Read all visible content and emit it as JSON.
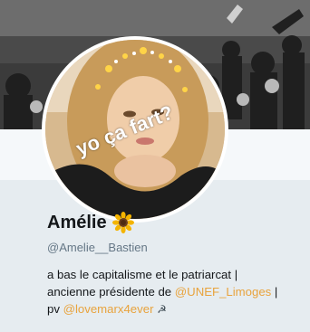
{
  "profile": {
    "name": "Amélie",
    "name_emoji": "sunflower-icon",
    "handle": "@Amelie__Bastien",
    "avatar_caption": "yo ça fart?",
    "bio": {
      "line1": "a bas le capitalisme et le patriarcat |",
      "line2_prefix": "ancienne présidente de ",
      "line2_link": "@UNEF_Limoges",
      "line2_suffix": " |",
      "line3_prefix": "pv ",
      "line3_link": "@lovemarx4ever",
      "line3_icon": "hammer-sickle-icon",
      "line3_icon_glyph": "☭"
    }
  },
  "colors": {
    "background": "#e6ecf0",
    "link": "#e8a33d",
    "name": "#14171a",
    "handle": "#657786"
  }
}
